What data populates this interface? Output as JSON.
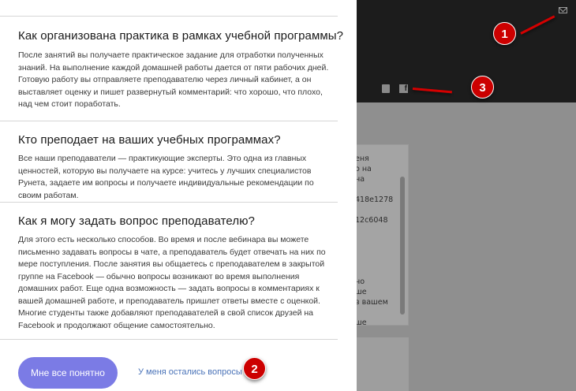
{
  "background": {
    "card_lines": "еня\nо на\nна\n\n418e1278\n\n12c6048\n\n\n\n\n\nно\nше\nв вашем\n\nше",
    "icons": [
      "mail-icon",
      "download-icon",
      "facebook-icon"
    ]
  },
  "faq": [
    {
      "question": "Как организована практика в рамках учебной программы?",
      "answer": "После занятий вы получаете практическое задание для отработки полученных знаний. На выполнение каждой домашней работы дается от пяти рабочих дней. Готовую работу вы отправляете преподавателю через личный кабинет, а он выставляет оценку и пишет развернутый комментарий: что хорошо, что плохо, над чем стоит поработать."
    },
    {
      "question": "Кто преподает на ваших учебных программах?",
      "answer": "Все наши преподаватели — практикующие эксперты. Это одна из главных ценностей, которую вы получаете на курсе: учитесь у лучших специалистов Рунета, задаете им вопросы и получаете индивидуальные рекомендации по своим работам."
    },
    {
      "question": "Как я могу задать вопрос преподавателю?",
      "answer": "Для этого есть несколько способов. Во время и после вебинара вы можете письменно задавать вопросы в чате, а преподаватель будет отвечать на них по мере поступления. После занятия вы общаетесь с преподавателем в закрытой группе на Facebook — обычно вопросы возникают во время выполнения домашних работ. Еще одна возможность — задать вопросы в комментариях к вашей домашней работе, и преподаватель пришлет ответы вместе с оценкой. Многие студенты также добавляют преподавателей в свой список друзей на Facebook и продолжают общение самостоятельно."
    }
  ],
  "actions": {
    "primary_label": "Мне все понятно",
    "secondary_label": "У меня остались вопросы"
  },
  "annotations": {
    "badge_1": "1",
    "badge_2": "2",
    "badge_3": "3",
    "color": "#cc0000"
  },
  "colors": {
    "primary_button": "#7b7be5",
    "link": "#4a73b8"
  }
}
